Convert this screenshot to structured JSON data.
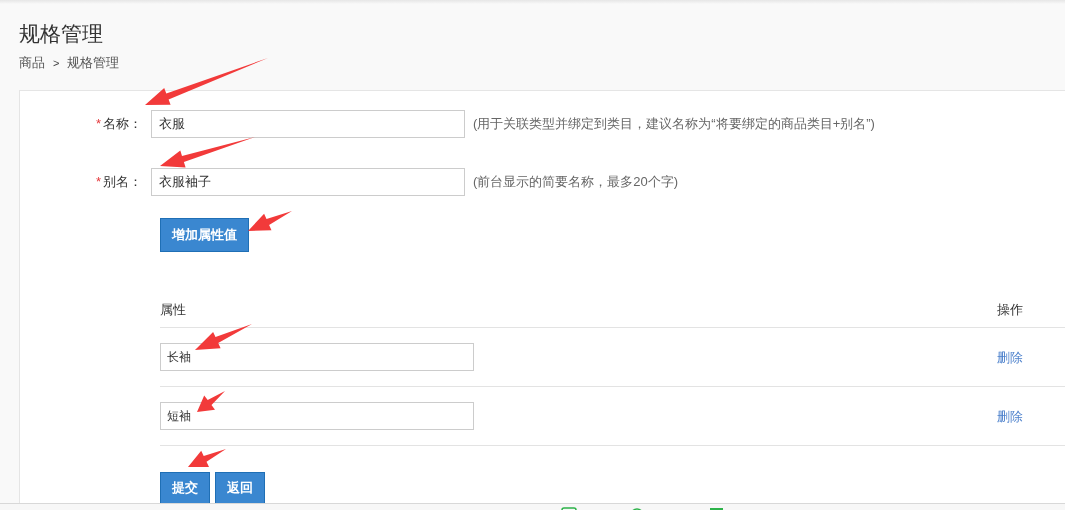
{
  "page": {
    "title": "规格管理"
  },
  "breadcrumb": [
    {
      "label": "商品"
    },
    {
      "separator": ">"
    },
    {
      "label": "规格管理"
    }
  ],
  "form": {
    "fields": [
      {
        "required_mark": "*",
        "label": "名称：",
        "value": "衣服",
        "hint": "(用于关联类型并绑定到类目，建议名称为“将要绑定的商品类目+别名”)"
      },
      {
        "required_mark": "*",
        "label": "别名：",
        "value": "衣服袖子",
        "hint": "(前台显示的简要名称，最多20个字)"
      }
    ],
    "add_button": "增加属性值",
    "table": {
      "columns": [
        "属性",
        "操作"
      ],
      "rows": [
        {
          "value": "长袖",
          "action": "删除"
        },
        {
          "value": "短袖",
          "action": "删除"
        }
      ]
    },
    "buttons": [
      "提交",
      "返回"
    ]
  }
}
